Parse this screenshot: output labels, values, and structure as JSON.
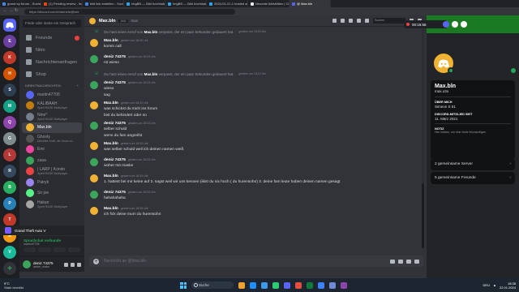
{
  "browser": {
    "tabs": [
      {
        "label": "grand ep forum - Suchen",
        "color": "#4285f4"
      },
      {
        "label": "(1) Pending review - Ihan roadblock",
        "color": "#ff4500"
      },
      {
        "label": "bild link erstellen - Suchen",
        "color": "#4285f4"
      },
      {
        "label": "ImgBB — Bild hochladen",
        "color": "#2ea3f2"
      },
      {
        "label": "ImgBB — Bild hochladen — ImgBB",
        "color": "#2ea3f2"
      },
      {
        "label": "2024-01-21-1 hosted at ImgBB",
        "color": "#2ea3f2"
      },
      {
        "label": "Neueste Aktivitäten | Cloud Rol",
        "color": "#e8eaed"
      },
      {
        "label": "@ Max.bln",
        "color": "#5865f2"
      }
    ],
    "url": "https://discord.com/channels/@me"
  },
  "servers": [
    "home",
    "E",
    "K",
    "H",
    "S",
    "M",
    "Q",
    "G",
    "L",
    "R",
    "B",
    "P",
    "T",
    "A",
    "V",
    "+"
  ],
  "dm_sidebar": {
    "search_placeholder": "Finde oder starte ein Gespräch",
    "nav": [
      "Freunde",
      "Nitro",
      "Nachrichtenanfragen",
      "Shop"
    ],
    "header": "Direktnachrichten",
    "header_add": "+",
    "items": [
      {
        "name": "martin47705",
        "status": "",
        "color": "#5865f2"
      },
      {
        "name": "KALIBAAH",
        "status": "Spielt RAGE Multiplayer",
        "color": "#c27c0e"
      },
      {
        "name": "Nine^",
        "status": "Spielt RAGE Multiplayer",
        "color": "#747f8d"
      },
      {
        "name": "Max.bln",
        "status": "",
        "color": "#f0b232"
      },
      {
        "name": "Ghosty",
        "status": "Dieselbe Kraft, die Jesus vo...",
        "color": "#545454"
      },
      {
        "name": "Emi",
        "status": "",
        "color": "#eb459e"
      },
      {
        "name": "zaaa",
        "status": "",
        "color": "#3ba55c"
      },
      {
        "name": "| LARP | Kondo",
        "status": "Spielt RAGE Multiplayer",
        "color": "#ed4245"
      },
      {
        "name": "Patryk",
        "status": "",
        "color": "#9b84ee"
      },
      {
        "name": "Sir joe",
        "status": "",
        "color": "#57f287"
      },
      {
        "name": "Hakan",
        "status": "Spielt RAGE Multiplayer",
        "color": "#a5a5a5"
      }
    ]
  },
  "game_bar": {
    "label": "Grand Theft Auto V"
  },
  "voice": {
    "title": "Sprachchat verbunde",
    "subtitle": "martin47705"
  },
  "user": {
    "name": "deniz 74375",
    "status": "weiter_make"
  },
  "chat": {
    "title": "Max.bln",
    "tag": "AKA",
    "tag_text": "max",
    "find_placeholder": "Suchen",
    "messages": [
      {
        "kind": "system",
        "prefix": "Du hast einen Anruf von",
        "who": "Max.bln",
        "suffix": "verpasst, der ein paar Sekunden gedauert hat.",
        "time": "gestern um 18:09 Uhr"
      },
      {
        "kind": "msg",
        "author": "Max.bln",
        "time": "gestern um 18:09 Uhr",
        "lines": [
          "komm call"
        ],
        "color": "#f0b232"
      },
      {
        "kind": "msg",
        "author": "deniz 74375",
        "time": "gestern um 18:09 Uhr",
        "lines": [
          "nö wieso"
        ],
        "color": "#3ba55c"
      },
      {
        "kind": "system",
        "prefix": "Du hast einen Anruf von",
        "who": "Max.bln",
        "suffix": "verpasst, der ein paar Sekunden gedauert hat.",
        "time": "gestern um 18:12 Uhr"
      },
      {
        "kind": "msg",
        "author": "deniz 74375",
        "time": "gestern um 18:23 Uhr",
        "lines": [
          "wieso",
          "sag"
        ],
        "color": "#3ba55c"
      },
      {
        "kind": "msg",
        "author": "Max.bln",
        "time": "gestern um 18:32 Uhr",
        "lines": [
          "was schickst du mich ins forum",
          "bist du behindert oder so"
        ],
        "color": "#f0b232"
      },
      {
        "kind": "msg",
        "author": "deniz 74375",
        "time": "gestern um 18:33 Uhr",
        "lines": [
          "selber schuld",
          "wenn du fam angreifst"
        ],
        "color": "#3ba55c"
      },
      {
        "kind": "msg",
        "author": "Max.bln",
        "time": "gestern um 18:33 Uhr",
        "lines": [
          "was selber schuld weil ich deinen namen weiß"
        ],
        "color": "#f0b232"
      },
      {
        "kind": "msg",
        "author": "deniz 74375",
        "time": "gestern um 18:33 Uhr",
        "lines": [
          "woher mit maske"
        ],
        "color": "#3ba55c"
      },
      {
        "kind": "msg",
        "author": "Max.bln",
        "time": "gestern um 18:34 Uhr",
        "lines": [
          "1. hattest bei mir keine auf 2. sagst weil wir uns kennen (ikist du nix hoch ( du hurensohn) 3. deine fam leute haben deinen namen gesagt"
        ],
        "color": "#f0b232"
      },
      {
        "kind": "msg",
        "author": "deniz 74375",
        "time": "gestern um 18:34 Uhr",
        "lines": [
          "hahahahaha"
        ],
        "color": "#3ba55c"
      },
      {
        "kind": "msg",
        "author": "Max.bln",
        "time": "gestern um 18:35 Uhr",
        "lines": [
          "ich fick deine mum du hurensohn"
        ],
        "color": "#f0b232"
      }
    ],
    "composer_placeholder": "Nachricht an @Max.bln"
  },
  "call": {
    "timer": "00:16:56"
  },
  "profile": {
    "name": "Max.bln",
    "username": "max.o3o",
    "about_label": "Über mich",
    "about": "Simeon S 51",
    "member_label": "Discord-Mitglied seit",
    "member_since": "11. März 2021",
    "note_label": "Notiz",
    "note": "Hier klicken, um eine Notiz hinzuzufügen",
    "servers": "2 gemeinsame Server",
    "friends": "5 gemeinsame Freunde"
  },
  "taskbar": {
    "weather_temp": "9°C",
    "weather_text": "Stark bewölkt",
    "search": "Suche",
    "apps": [
      "#f0a030",
      "#1e90ff",
      "#3d9be9",
      "#2ecc71",
      "#5865f2",
      "#e74c3c",
      "#0f7b3b",
      "#3b82f6",
      "#7289da",
      "#8e44ad"
    ],
    "lang": "DEU",
    "time": "18:38",
    "date": "22.01.2024"
  }
}
